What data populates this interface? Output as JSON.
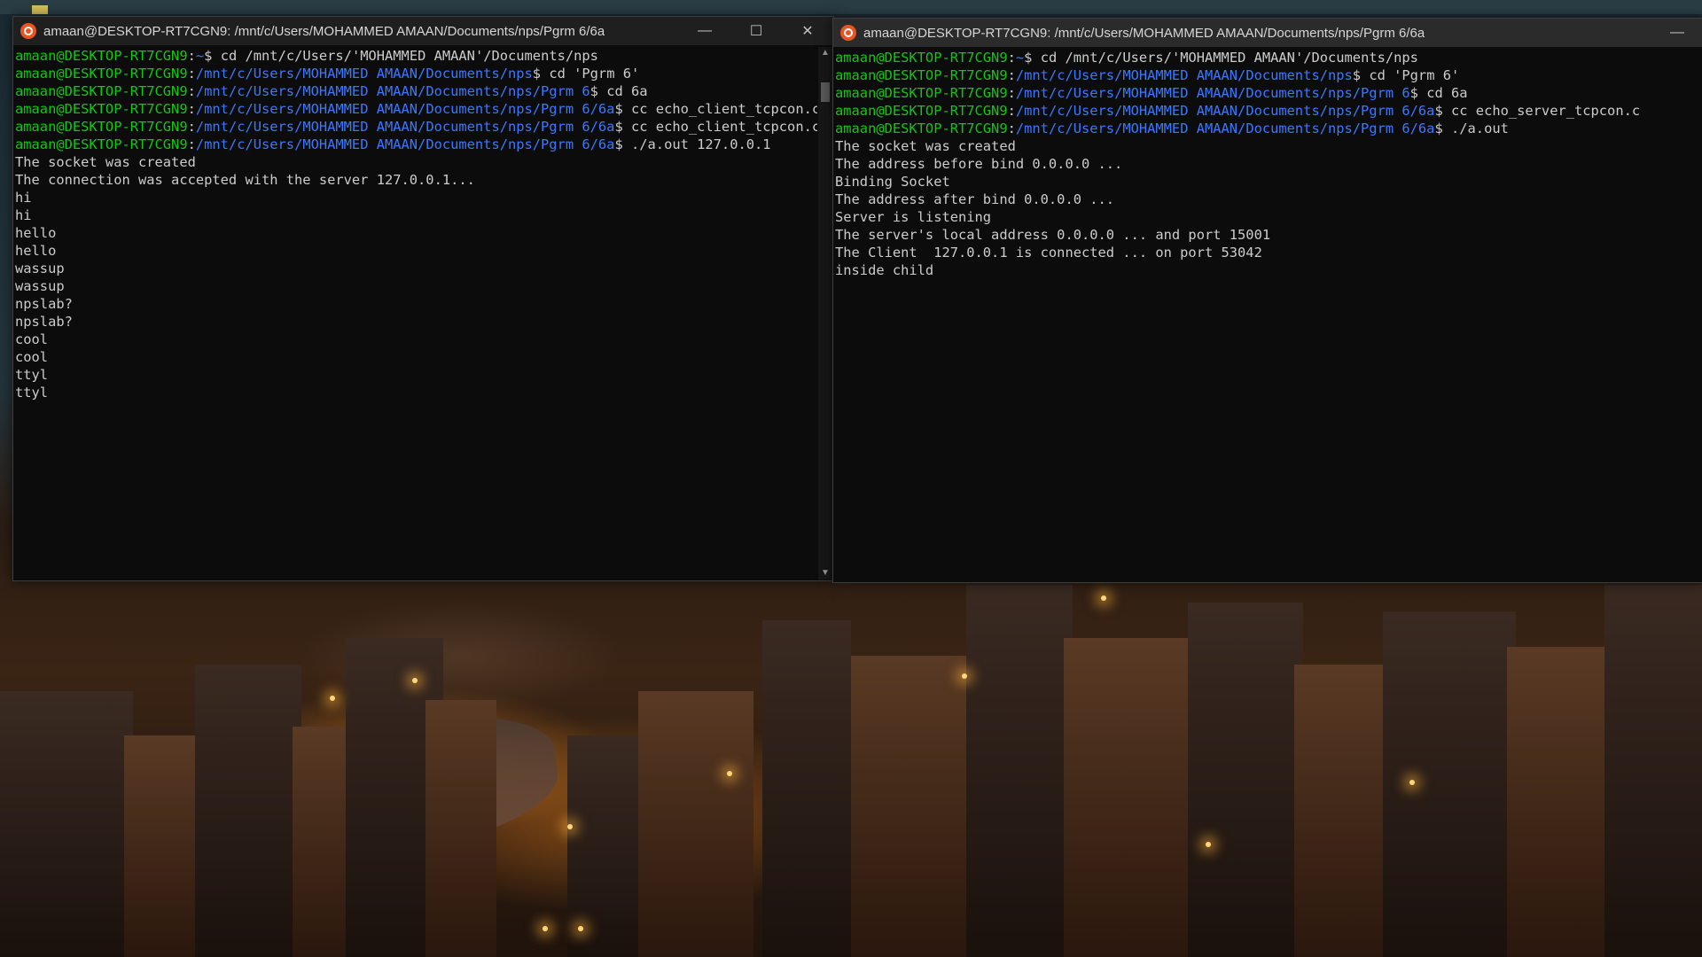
{
  "client_window": {
    "title": "amaan@DESKTOP-RT7CGN9: /mnt/c/Users/MOHAMMED AMAAN/Documents/nps/Pgrm 6/6a",
    "controls": {
      "minimize": "—",
      "maximize": "☐",
      "close": "✕"
    },
    "prompt_lines": [
      {
        "user": "amaan@DESKTOP-RT7CGN9",
        "path": "~",
        "cmd": "cd /mnt/c/Users/'MOHAMMED AMAAN'/Documents/nps"
      },
      {
        "user": "amaan@DESKTOP-RT7CGN9",
        "path": "/mnt/c/Users/MOHAMMED AMAAN/Documents/nps",
        "cmd": "cd 'Pgrm 6'"
      },
      {
        "user": "amaan@DESKTOP-RT7CGN9",
        "path": "/mnt/c/Users/MOHAMMED AMAAN/Documents/nps/Pgrm 6",
        "cmd": "cd 6a"
      },
      {
        "user": "amaan@DESKTOP-RT7CGN9",
        "path": "/mnt/c/Users/MOHAMMED AMAAN/Documents/nps/Pgrm 6/6a",
        "cmd": "cc echo_client_tcpcon.c"
      },
      {
        "user": "amaan@DESKTOP-RT7CGN9",
        "path": "/mnt/c/Users/MOHAMMED AMAAN/Documents/nps/Pgrm 6/6a",
        "cmd": "cc echo_client_tcpcon.c"
      },
      {
        "user": "amaan@DESKTOP-RT7CGN9",
        "path": "/mnt/c/Users/MOHAMMED AMAAN/Documents/nps/Pgrm 6/6a",
        "cmd": "./a.out 127.0.0.1"
      }
    ],
    "output_lines": [
      "The socket was created",
      "The connection was accepted with the server 127.0.0.1...",
      "hi",
      "hi",
      "hello",
      "hello",
      "wassup",
      "wassup",
      "npslab?",
      "npslab?",
      "cool",
      "cool",
      "ttyl",
      "ttyl"
    ],
    "scrollbar": {
      "up": "▲",
      "down": "▼"
    }
  },
  "server_window": {
    "title": "amaan@DESKTOP-RT7CGN9: /mnt/c/Users/MOHAMMED AMAAN/Documents/nps/Pgrm 6/6a",
    "controls": {
      "minimize": "—"
    },
    "prompt_lines": [
      {
        "user": "amaan@DESKTOP-RT7CGN9",
        "path": "~",
        "cmd": "cd /mnt/c/Users/'MOHAMMED AMAAN'/Documents/nps"
      },
      {
        "user": "amaan@DESKTOP-RT7CGN9",
        "path": "/mnt/c/Users/MOHAMMED AMAAN/Documents/nps",
        "cmd": "cd 'Pgrm 6'"
      },
      {
        "user": "amaan@DESKTOP-RT7CGN9",
        "path": "/mnt/c/Users/MOHAMMED AMAAN/Documents/nps/Pgrm 6",
        "cmd": "cd 6a"
      },
      {
        "user": "amaan@DESKTOP-RT7CGN9",
        "path": "/mnt/c/Users/MOHAMMED AMAAN/Documents/nps/Pgrm 6/6a",
        "cmd": "cc echo_server_tcpcon.c"
      },
      {
        "user": "amaan@DESKTOP-RT7CGN9",
        "path": "/mnt/c/Users/MOHAMMED AMAAN/Documents/nps/Pgrm 6/6a",
        "cmd": "./a.out"
      }
    ],
    "output_lines": [
      "The socket was created",
      "The address before bind 0.0.0.0 ...",
      "Binding Socket",
      "The address after bind 0.0.0.0 ...",
      "Server is listening",
      "The server's local address 0.0.0.0 ... and port 15001",
      "The Client  127.0.0.1 is connected ... on port 53042",
      "inside child"
    ]
  },
  "colors": {
    "prompt_user": "#13c613",
    "prompt_path": "#3b78ff",
    "terminal_text": "#cccccc",
    "terminal_bg": "#0c0c0c",
    "ubuntu_orange": "#e95420"
  },
  "icons": [
    "ubuntu-icon",
    "minimize-icon",
    "maximize-icon",
    "close-icon",
    "scroll-up-icon",
    "scroll-down-icon"
  ]
}
